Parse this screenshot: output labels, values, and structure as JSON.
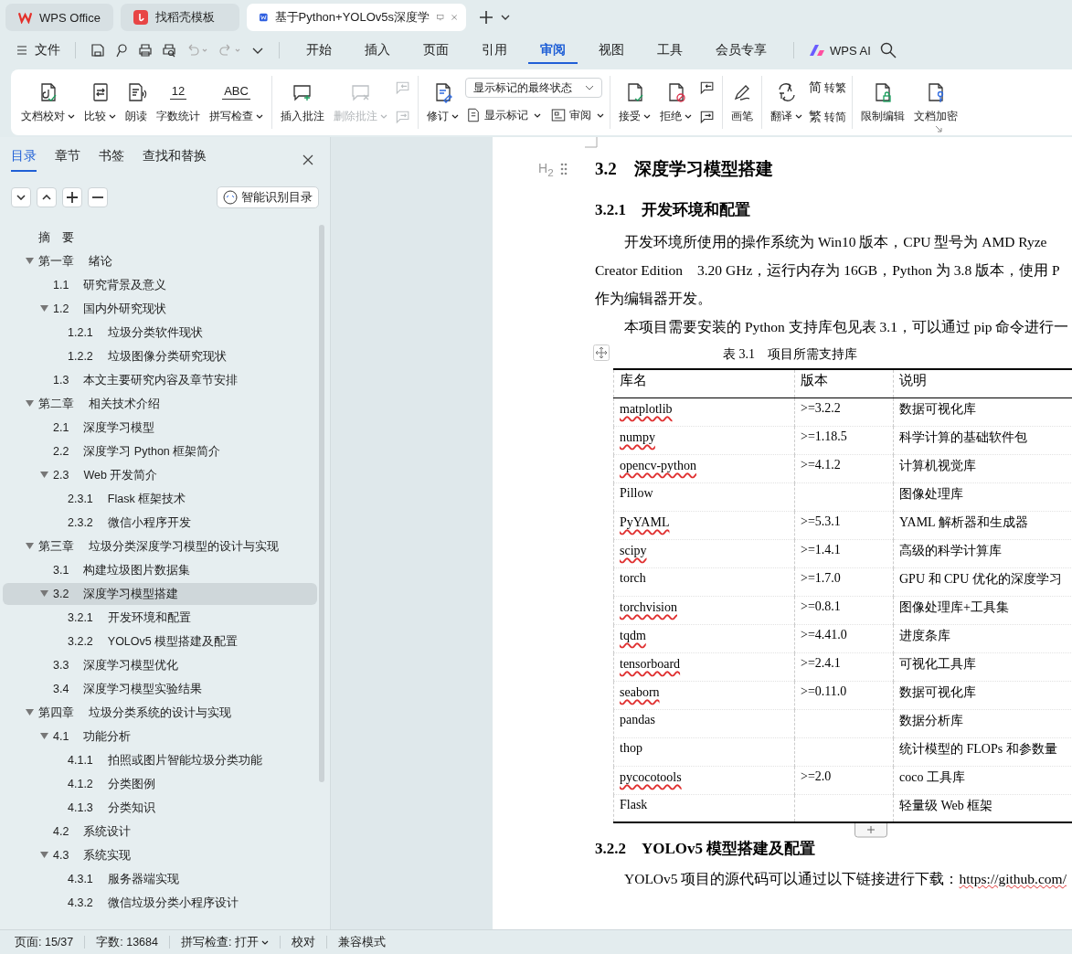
{
  "window_tabs": [
    {
      "label": "WPS Office",
      "kind": "home",
      "selected": false
    },
    {
      "label": "找稻壳模板",
      "kind": "template",
      "selected": false
    },
    {
      "label": "基于Python+YOLOv5s深度学",
      "kind": "doc",
      "selected": true
    }
  ],
  "menu": {
    "file": "文件",
    "tabs": [
      {
        "label": "开始",
        "selected": false
      },
      {
        "label": "插入",
        "selected": false
      },
      {
        "label": "页面",
        "selected": false
      },
      {
        "label": "引用",
        "selected": false
      },
      {
        "label": "审阅",
        "selected": true
      },
      {
        "label": "视图",
        "selected": false
      },
      {
        "label": "工具",
        "selected": false
      },
      {
        "label": "会员专享",
        "selected": false
      }
    ],
    "ai": "WPS AI"
  },
  "ribbon": [
    {
      "items": [
        {
          "kind": "large",
          "label": "文档校对",
          "dropdown": true,
          "disabled": false
        },
        {
          "kind": "large",
          "label": "比较",
          "dropdown": true,
          "disabled": false
        },
        {
          "kind": "large",
          "label": "朗读",
          "dropdown": false,
          "disabled": false
        },
        {
          "kind": "large",
          "label": "字数统计",
          "glyph": "12",
          "dropdown": false,
          "disabled": false
        },
        {
          "kind": "large",
          "label": "拼写检查",
          "glyph": "ABC",
          "dropdown": true,
          "disabled": false
        }
      ]
    },
    {
      "items": [
        {
          "kind": "large",
          "label": "插入批注",
          "dropdown": false,
          "disabled": false
        },
        {
          "kind": "large",
          "label": "删除批注",
          "dropdown": true,
          "disabled": true
        },
        {
          "kind": "stack",
          "rows": [
            [
              {
                "kind": "icon",
                "disabled": true
              }
            ],
            [
              {
                "kind": "icon",
                "disabled": true
              }
            ]
          ]
        }
      ]
    },
    {
      "items": [
        {
          "kind": "large",
          "label": "修订",
          "dropdown": true,
          "disabled": false
        },
        {
          "kind": "stack",
          "rows": [
            [
              {
                "kind": "select",
                "value": "显示标记的最终状态"
              }
            ],
            [
              {
                "kind": "small",
                "label": "显示标记",
                "dropdown": true,
                "disabled": false
              },
              {
                "kind": "small",
                "label": "审阅",
                "dropdown": true,
                "disabled": false
              }
            ]
          ]
        }
      ]
    },
    {
      "items": [
        {
          "kind": "large",
          "label": "接受",
          "dropdown": true,
          "disabled": false
        },
        {
          "kind": "large",
          "label": "拒绝",
          "dropdown": true,
          "disabled": false
        },
        {
          "kind": "stack",
          "rows": [
            [
              {
                "kind": "icon",
                "disabled": false
              }
            ],
            [
              {
                "kind": "icon",
                "disabled": false
              }
            ]
          ]
        }
      ]
    },
    {
      "items": [
        {
          "kind": "large",
          "label": "画笔",
          "dropdown": false,
          "disabled": false
        }
      ]
    },
    {
      "items": [
        {
          "kind": "large",
          "label": "翻译",
          "dropdown": true,
          "disabled": false
        },
        {
          "kind": "stack",
          "rows": [
            [
              {
                "kind": "small",
                "glyph": "简",
                "label": "转繁",
                "dropdown": false,
                "disabled": false
              }
            ],
            [
              {
                "kind": "small",
                "glyph": "繁",
                "label": "转简",
                "dropdown": false,
                "disabled": false
              }
            ]
          ]
        }
      ]
    },
    {
      "items": [
        {
          "kind": "large",
          "label": "限制编辑",
          "dropdown": false,
          "disabled": false
        },
        {
          "kind": "large",
          "label": "文档加密",
          "dropdown": false,
          "disabled": false
        }
      ]
    }
  ],
  "nav_panel": {
    "tabs": [
      {
        "label": "目录",
        "selected": true
      },
      {
        "label": "章节",
        "selected": false
      },
      {
        "label": "书签",
        "selected": false
      },
      {
        "label": "查找和替换",
        "selected": false
      }
    ],
    "smart_button": "智能识别目录",
    "toc": [
      {
        "title": "摘　要",
        "selected": false
      },
      {
        "number": "第一章",
        "title": "绪论",
        "selected": false,
        "expanded": true,
        "children": [
          {
            "number": "1.1",
            "title": "研究背景及意义",
            "selected": false
          },
          {
            "number": "1.2",
            "title": "国内外研究现状",
            "selected": false,
            "expanded": true,
            "children": [
              {
                "number": "1.2.1",
                "title": "垃圾分类软件现状",
                "selected": false
              },
              {
                "number": "1.2.2",
                "title": "垃圾图像分类研究现状",
                "selected": false
              }
            ]
          },
          {
            "number": "1.3",
            "title": "本文主要研究内容及章节安排",
            "selected": false
          }
        ]
      },
      {
        "number": "第二章",
        "title": "相关技术介绍",
        "selected": false,
        "expanded": true,
        "children": [
          {
            "number": "2.1",
            "title": "深度学习模型",
            "selected": false
          },
          {
            "number": "2.2",
            "title": "深度学习 Python 框架简介",
            "selected": false
          },
          {
            "number": "2.3",
            "title": "Web 开发简介",
            "selected": false,
            "expanded": true,
            "children": [
              {
                "number": "2.3.1",
                "title": "Flask 框架技术",
                "selected": false
              },
              {
                "number": "2.3.2",
                "title": "微信小程序开发",
                "selected": false
              }
            ]
          }
        ]
      },
      {
        "number": "第三章",
        "title": "垃圾分类深度学习模型的设计与实现",
        "selected": false,
        "expanded": true,
        "children": [
          {
            "number": "3.1",
            "title": "构建垃圾图片数据集",
            "selected": false
          },
          {
            "number": "3.2",
            "title": "深度学习模型搭建",
            "selected": true,
            "expanded": true,
            "children": [
              {
                "number": "3.2.1",
                "title": "开发环境和配置",
                "selected": false
              },
              {
                "number": "3.2.2",
                "title": "YOLOv5 模型搭建及配置",
                "selected": false
              }
            ]
          },
          {
            "number": "3.3",
            "title": "深度学习模型优化",
            "selected": false
          },
          {
            "number": "3.4",
            "title": "深度学习模型实验结果",
            "selected": false
          }
        ]
      },
      {
        "number": "第四章",
        "title": "垃圾分类系统的设计与实现",
        "selected": false,
        "expanded": true,
        "children": [
          {
            "number": "4.1",
            "title": "功能分析",
            "selected": false,
            "expanded": true,
            "children": [
              {
                "number": "4.1.1",
                "title": "拍照或图片智能垃圾分类功能",
                "selected": false
              },
              {
                "number": "4.1.2",
                "title": "分类图例",
                "selected": false
              },
              {
                "number": "4.1.3",
                "title": "分类知识",
                "selected": false
              }
            ]
          },
          {
            "number": "4.2",
            "title": "系统设计",
            "selected": false
          },
          {
            "number": "4.3",
            "title": "系统实现",
            "selected": false,
            "expanded": true,
            "children": [
              {
                "number": "4.3.1",
                "title": "服务器端实现",
                "selected": false
              },
              {
                "number": "4.3.2",
                "title": "微信垃圾分类小程序设计",
                "selected": false
              }
            ]
          }
        ]
      }
    ]
  },
  "document": {
    "heading_marker": "H$_{2}$",
    "heading": "3.2　深度学习模型搭建",
    "subheading": "3.2.1　开发环境和配置",
    "paragraph_1": [
      "开发环境所使用的操作系统为 Win10 版本，CPU 型号为 AMD Ryze",
      "Creator Edition　3.20 GHz，运行内存为 16GB，Python 为 3.8 版本，使用 P",
      "作为编辑器开发。"
    ],
    "paragraph_2": "本项目需要安装的 Python 支持库包见表 3.1，可以通过 pip 命令进行一",
    "table_caption": "表 3.1　项目所需支持库",
    "table": {
      "columns": [
        "库名",
        "版本",
        "说明"
      ],
      "rows": [
        {
          "name": "matplotlib",
          "spell_error": true,
          "version": ">=3.2.2",
          "description": "数据可视化库"
        },
        {
          "name": "numpy",
          "spell_error": true,
          "version": ">=1.18.5",
          "description": "科学计算的基础软件包"
        },
        {
          "name": "opencv-python",
          "spell_error": true,
          "version": ">=4.1.2",
          "description": "计算机视觉库"
        },
        {
          "name": "Pillow",
          "spell_error": false,
          "description": "图像处理库"
        },
        {
          "name": "PyYAML",
          "spell_error": true,
          "version": ">=5.3.1",
          "description": "YAML 解析器和生成器"
        },
        {
          "name": "scipy",
          "spell_error": true,
          "version": ">=1.4.1",
          "description": "高级的科学计算库"
        },
        {
          "name": "torch",
          "spell_error": false,
          "version": ">=1.7.0",
          "description": "GPU 和 CPU 优化的深度学习"
        },
        {
          "name": "torchvision",
          "spell_error": true,
          "version": ">=0.8.1",
          "description": "图像处理库+工具集"
        },
        {
          "name": "tqdm",
          "spell_error": true,
          "version": ">=4.41.0",
          "description": "进度条库"
        },
        {
          "name": "tensorboard",
          "spell_error": true,
          "version": ">=2.4.1",
          "description": "可视化工具库"
        },
        {
          "name": "seaborn",
          "spell_error": true,
          "version": ">=0.11.0",
          "description": "数据可视化库"
        },
        {
          "name": "pandas",
          "spell_error": false,
          "description": "数据分析库"
        },
        {
          "name": "thop",
          "spell_error": false,
          "description": "统计模型的 FLOPs 和参数量"
        },
        {
          "name": "pycocotools",
          "spell_error": true,
          "version": ">=2.0",
          "description": "coco 工具库"
        },
        {
          "name": "Flask",
          "spell_error": false,
          "description": "轻量级 Web 框架"
        }
      ]
    },
    "subheading_2": "3.2.2　YOLOv5 模型搭建及配置",
    "paragraph_3_start": "YOLOv5 项目的源代码可以通过以下链接进行下载：",
    "paragraph_3_link": "https://github.com/"
  },
  "status_bar": [
    "页面: 15/37",
    "字数: 13684",
    "拼写检查: 打开",
    "校对",
    "兼容模式"
  ]
}
